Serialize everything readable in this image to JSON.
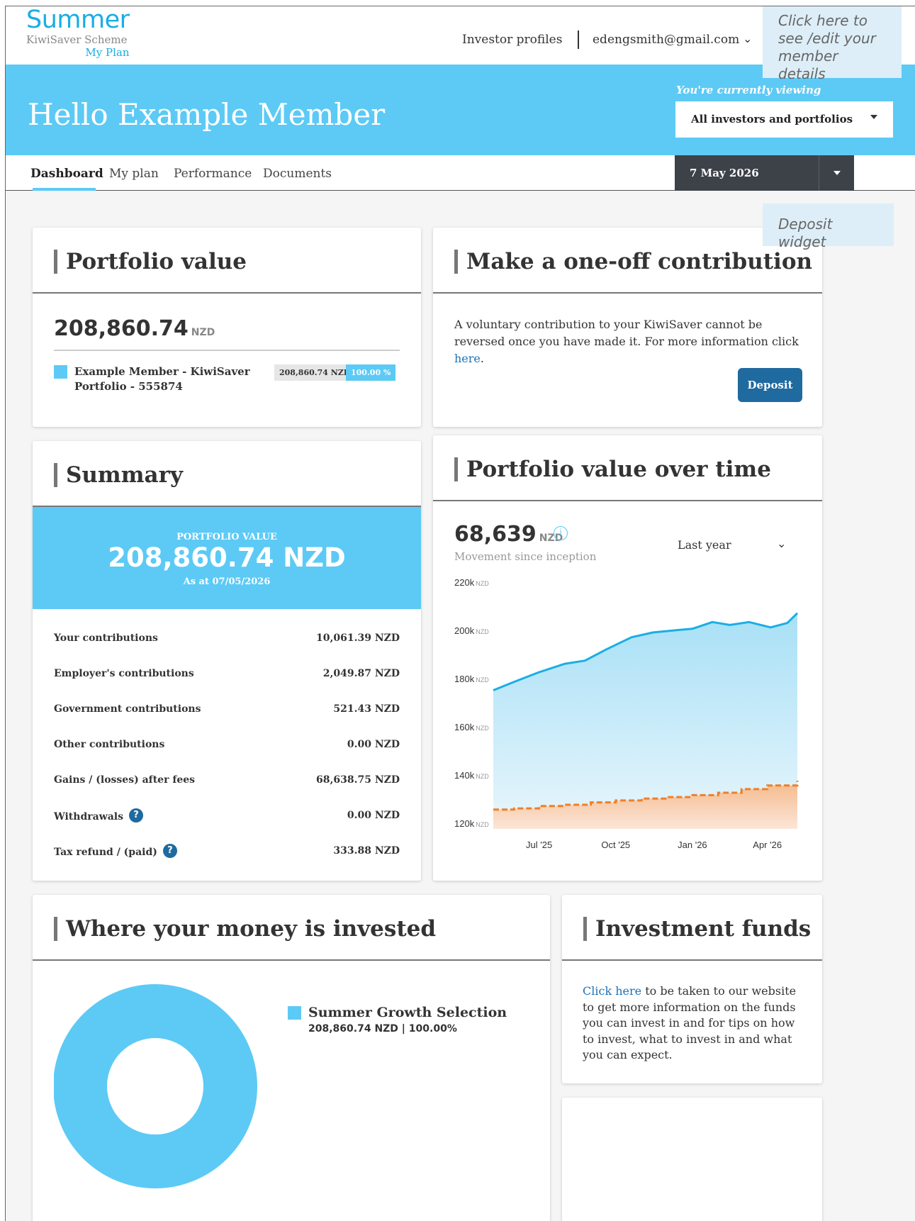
{
  "logo": {
    "brand": "Summer",
    "line2": "KiwiSaver Scheme",
    "line3": "My Plan"
  },
  "topnav": {
    "profiles": "Investor profiles",
    "email": "edengsmith@gmail.com",
    "chevron_icon": "chevron-down-icon"
  },
  "callouts": {
    "member": "Click here to see /edit your member details",
    "deposit": "Deposit widget"
  },
  "hero": {
    "title": "Hello Example Member",
    "viewing_label": "You're currently viewing",
    "viewing_value": "All investors and portfolios"
  },
  "tabs": [
    {
      "label": "Dashboard",
      "active": true
    },
    {
      "label": "My plan"
    },
    {
      "label": "Performance"
    },
    {
      "label": "Documents"
    }
  ],
  "date_select": "7 May 2026",
  "portfolio_value": {
    "title": "Portfolio value",
    "amount": "208,860.74",
    "currency": "NZD",
    "item_name": "Example Member - KiwiSaver",
    "item_sub": "Portfolio - 555874",
    "item_value": "208,860.74 NZD",
    "item_pct": "100.00 %"
  },
  "contribution": {
    "title": "Make a one-off contribution",
    "text": "A voluntary contribution to your KiwiSaver cannot be reversed once you have made it. For more information click ",
    "link": "here",
    "text_end": ".",
    "button": "Deposit"
  },
  "summary": {
    "title": "Summary",
    "hero_label": "PORTFOLIO VALUE",
    "hero_value": "208,860.74 NZD",
    "hero_asat": "As at 07/05/2026",
    "rows": [
      {
        "label": "Your contributions",
        "value": "10,061.39 NZD"
      },
      {
        "label": "Employer's contributions",
        "value": "2,049.87 NZD"
      },
      {
        "label": "Government contributions",
        "value": "521.43 NZD"
      },
      {
        "label": "Other contributions",
        "value": "0.00 NZD"
      },
      {
        "label": "Gains / (losses) after fees",
        "value": "68,638.75 NZD"
      },
      {
        "label": "Withdrawals",
        "value": "0.00 NZD",
        "help": "?"
      },
      {
        "label": "Tax refund / (paid)",
        "value": "333.88 NZD",
        "help": "?"
      }
    ]
  },
  "pvt": {
    "title": "Portfolio value over time",
    "amount": "68,639",
    "currency": "NZD",
    "info": "i",
    "subtitle": "Movement since inception",
    "range": "Last year"
  },
  "chart_data": {
    "type": "area",
    "y_unit": "NZD",
    "ylim": [
      120000,
      220000
    ],
    "y_ticks": [
      "220k",
      "200k",
      "180k",
      "160k",
      "140k",
      "120k"
    ],
    "y_tick_values": [
      220000,
      200000,
      180000,
      160000,
      140000,
      120000
    ],
    "x_ticks": [
      "Jul '25",
      "Oct '25",
      "Jan '26",
      "Apr '26"
    ],
    "x_tick_dates": [
      "2025-07-01",
      "2025-10-01",
      "2026-01-01",
      "2026-04-01"
    ],
    "x_range": [
      "2025-05-07",
      "2026-05-07"
    ],
    "colors": {
      "value": "#1aaee5",
      "contributions": "#f07f2a"
    },
    "series": [
      {
        "style": "solid",
        "points": [
          [
            "2025-05-07",
            177500
          ],
          [
            "2025-06-01",
            181000
          ],
          [
            "2025-07-01",
            185000
          ],
          [
            "2025-08-01",
            188500
          ],
          [
            "2025-08-25",
            189800
          ],
          [
            "2025-09-20",
            194500
          ],
          [
            "2025-10-20",
            199500
          ],
          [
            "2025-11-15",
            201500
          ],
          [
            "2025-12-15",
            202500
          ],
          [
            "2026-01-01",
            203000
          ],
          [
            "2026-01-25",
            205800
          ],
          [
            "2026-02-15",
            204600
          ],
          [
            "2026-03-10",
            205800
          ],
          [
            "2026-04-05",
            203600
          ],
          [
            "2026-04-25",
            205400
          ],
          [
            "2026-05-07",
            209500
          ]
        ]
      },
      {
        "style": "dashed",
        "points": [
          [
            "2025-05-07",
            128000
          ],
          [
            "2025-06-01",
            128500
          ],
          [
            "2025-07-01",
            129500
          ],
          [
            "2025-08-01",
            130000
          ],
          [
            "2025-09-01",
            131000
          ],
          [
            "2025-10-01",
            131800
          ],
          [
            "2025-11-01",
            132600
          ],
          [
            "2025-12-01",
            133200
          ],
          [
            "2026-01-01",
            134000
          ],
          [
            "2026-02-01",
            135000
          ],
          [
            "2026-03-01",
            136500
          ],
          [
            "2026-04-01",
            138000
          ],
          [
            "2026-05-07",
            140000
          ]
        ]
      }
    ]
  },
  "where": {
    "title": "Where your money is invested",
    "fund": "Summer Growth Selection",
    "fund_value": "208,860.74 NZD | 100.00%",
    "fund_pct": 100
  },
  "funds": {
    "title": "Investment funds",
    "link": "Click here",
    "text": " to be taken to our website to get more information on the funds you can invest in and for tips on how to invest, what to invest in and what you can expect."
  }
}
